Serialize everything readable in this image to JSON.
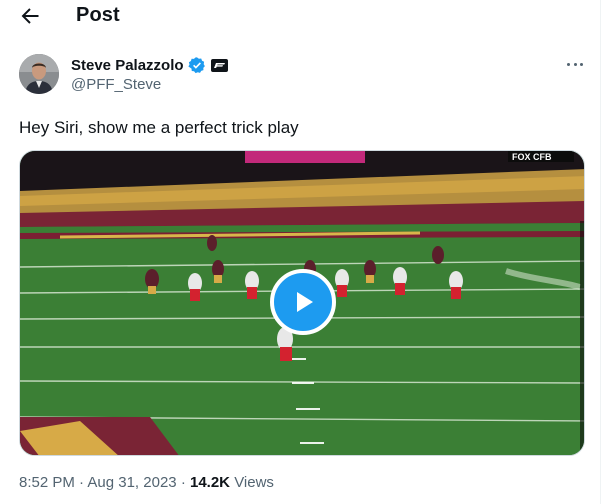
{
  "header": {
    "title": "Post",
    "back_icon": "arrow-left-icon"
  },
  "author": {
    "name": "Steve Palazzolo",
    "handle": "@PFF_Steve",
    "verified_icon": "verified-badge-icon",
    "affiliate_icon": "pff-logo-icon",
    "avatar": "avatar"
  },
  "more_icon": "more-options-icon",
  "tweet": {
    "text": "Hey Siri, show me a perfect trick play"
  },
  "media": {
    "type": "video",
    "play_icon": "play-icon",
    "broadcast_logo": "FOX CFB",
    "accent_color": "#1d9bf0"
  },
  "meta": {
    "time": "8:52 PM",
    "separator": "·",
    "date": "Aug 31, 2023",
    "views_count": "14.2K",
    "views_label": "Views"
  }
}
